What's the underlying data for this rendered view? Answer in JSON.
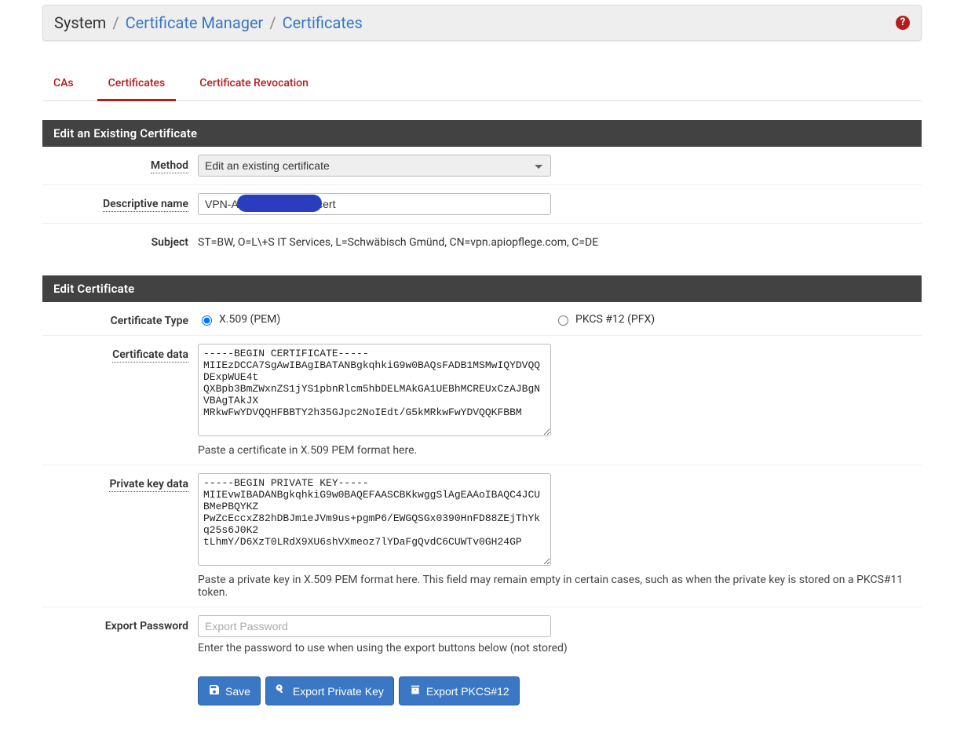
{
  "breadcrumb": {
    "root": "System",
    "mid": "Certificate Manager",
    "leaf": "Certificates"
  },
  "tabs": {
    "cas": "CAs",
    "certs": "Certificates",
    "crl": "Certificate Revocation"
  },
  "panel1": {
    "title": "Edit an Existing Certificate",
    "method_label": "Method",
    "method_value": "Edit an existing certificate",
    "name_label": "Descriptive name",
    "name_value": "VPN-A                          cert",
    "subject_label": "Subject",
    "subject_value": "ST=BW, O=L\\+S IT Services, L=Schwäbisch Gmünd, CN=vpn.apiopflege.com, C=DE"
  },
  "panel2": {
    "title": "Edit Certificate",
    "certtype_label": "Certificate Type",
    "certtype_pem": "X.509 (PEM)",
    "certtype_pfx": "PKCS #12 (PFX)",
    "certdata_label": "Certificate data",
    "certdata_value": "-----BEGIN CERTIFICATE-----\nMIIEzDCCA7SgAwIBAgIBATANBgkqhkiG9w0BAQsFADB1MSMwIQYDVQQDExpWUE4t\nQXBpb3BmZWxnZS1jYS1pbnRlcm5hbDELMAkGA1UEBhMCREUxCzAJBgNVBAgTAkJX\nMRkwFwYDVQQHFBBTY2h35GJpc2NoIEdt/G5kMRkwFwYDVQQKFBBM",
    "certdata_help": "Paste a certificate in X.509 PEM format here.",
    "keydata_label": "Private key data",
    "keydata_value": "-----BEGIN PRIVATE KEY-----\nMIIEvwIBADANBgkqhkiG9w0BAQEFAASCBKkwggSlAgEAAoIBAQC4JCUBMePBQYKZ\nPwZcEccxZ82hDBJm1eJVm9us+pgmP6/EWGQSGx0390HnFD88ZEjThYkq25s6J0K2\ntLhmY/D6XzT0LRdX9XU6shVXmeoz7lYDaFgQvdC6CUWTv0GH24GP",
    "keydata_help": "Paste a private key in X.509 PEM format here. This field may remain empty in certain cases, such as when the private key is stored on a PKCS#11 token.",
    "exportpw_label": "Export Password",
    "exportpw_placeholder": "Export Password",
    "exportpw_help": "Enter the password to use when using the export buttons below (not stored)"
  },
  "buttons": {
    "save": "Save",
    "export_key": "Export Private Key",
    "export_p12": "Export PKCS#12"
  }
}
